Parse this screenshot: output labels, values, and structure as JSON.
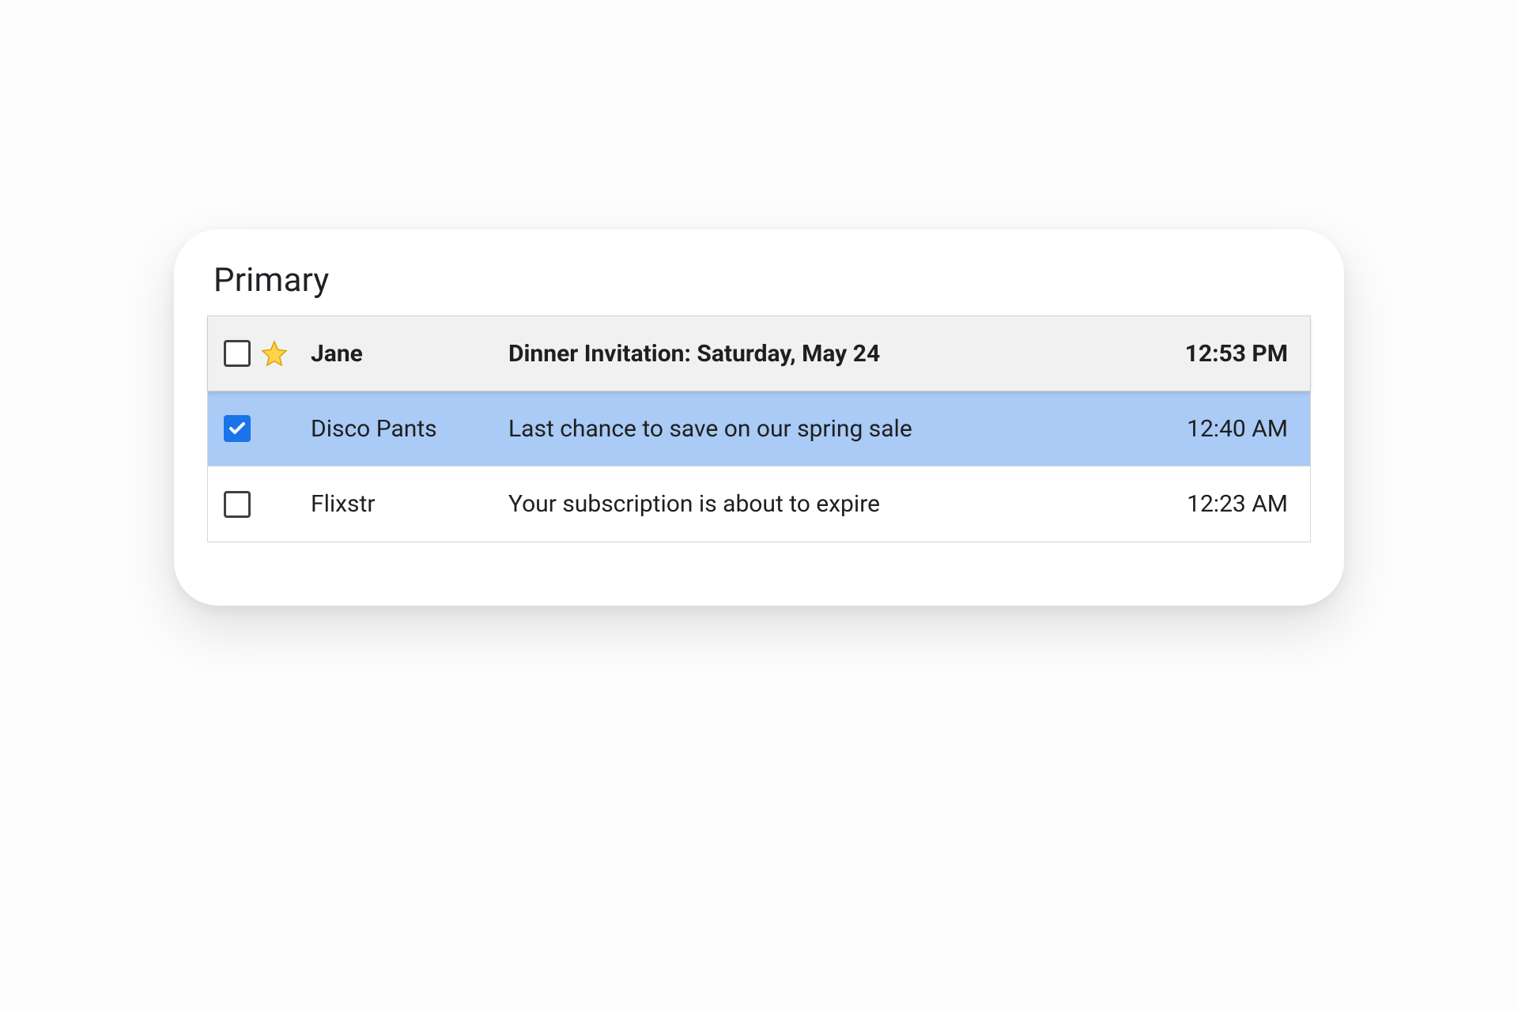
{
  "section_title": "Primary",
  "emails": [
    {
      "sender": "Jane",
      "subject": "Dinner Invitation: Saturday, May 24",
      "time": "12:53 PM",
      "checked": false,
      "starred": true,
      "unread": true,
      "hovered": true,
      "selected": false
    },
    {
      "sender": "Disco Pants",
      "subject": "Last chance to save on our spring sale",
      "time": "12:40 AM",
      "checked": true,
      "starred": false,
      "unread": false,
      "hovered": false,
      "selected": true
    },
    {
      "sender": "Flixstr",
      "subject": "Your subscription is about to expire",
      "time": "12:23 AM",
      "checked": false,
      "starred": false,
      "unread": false,
      "hovered": false,
      "selected": false
    }
  ]
}
